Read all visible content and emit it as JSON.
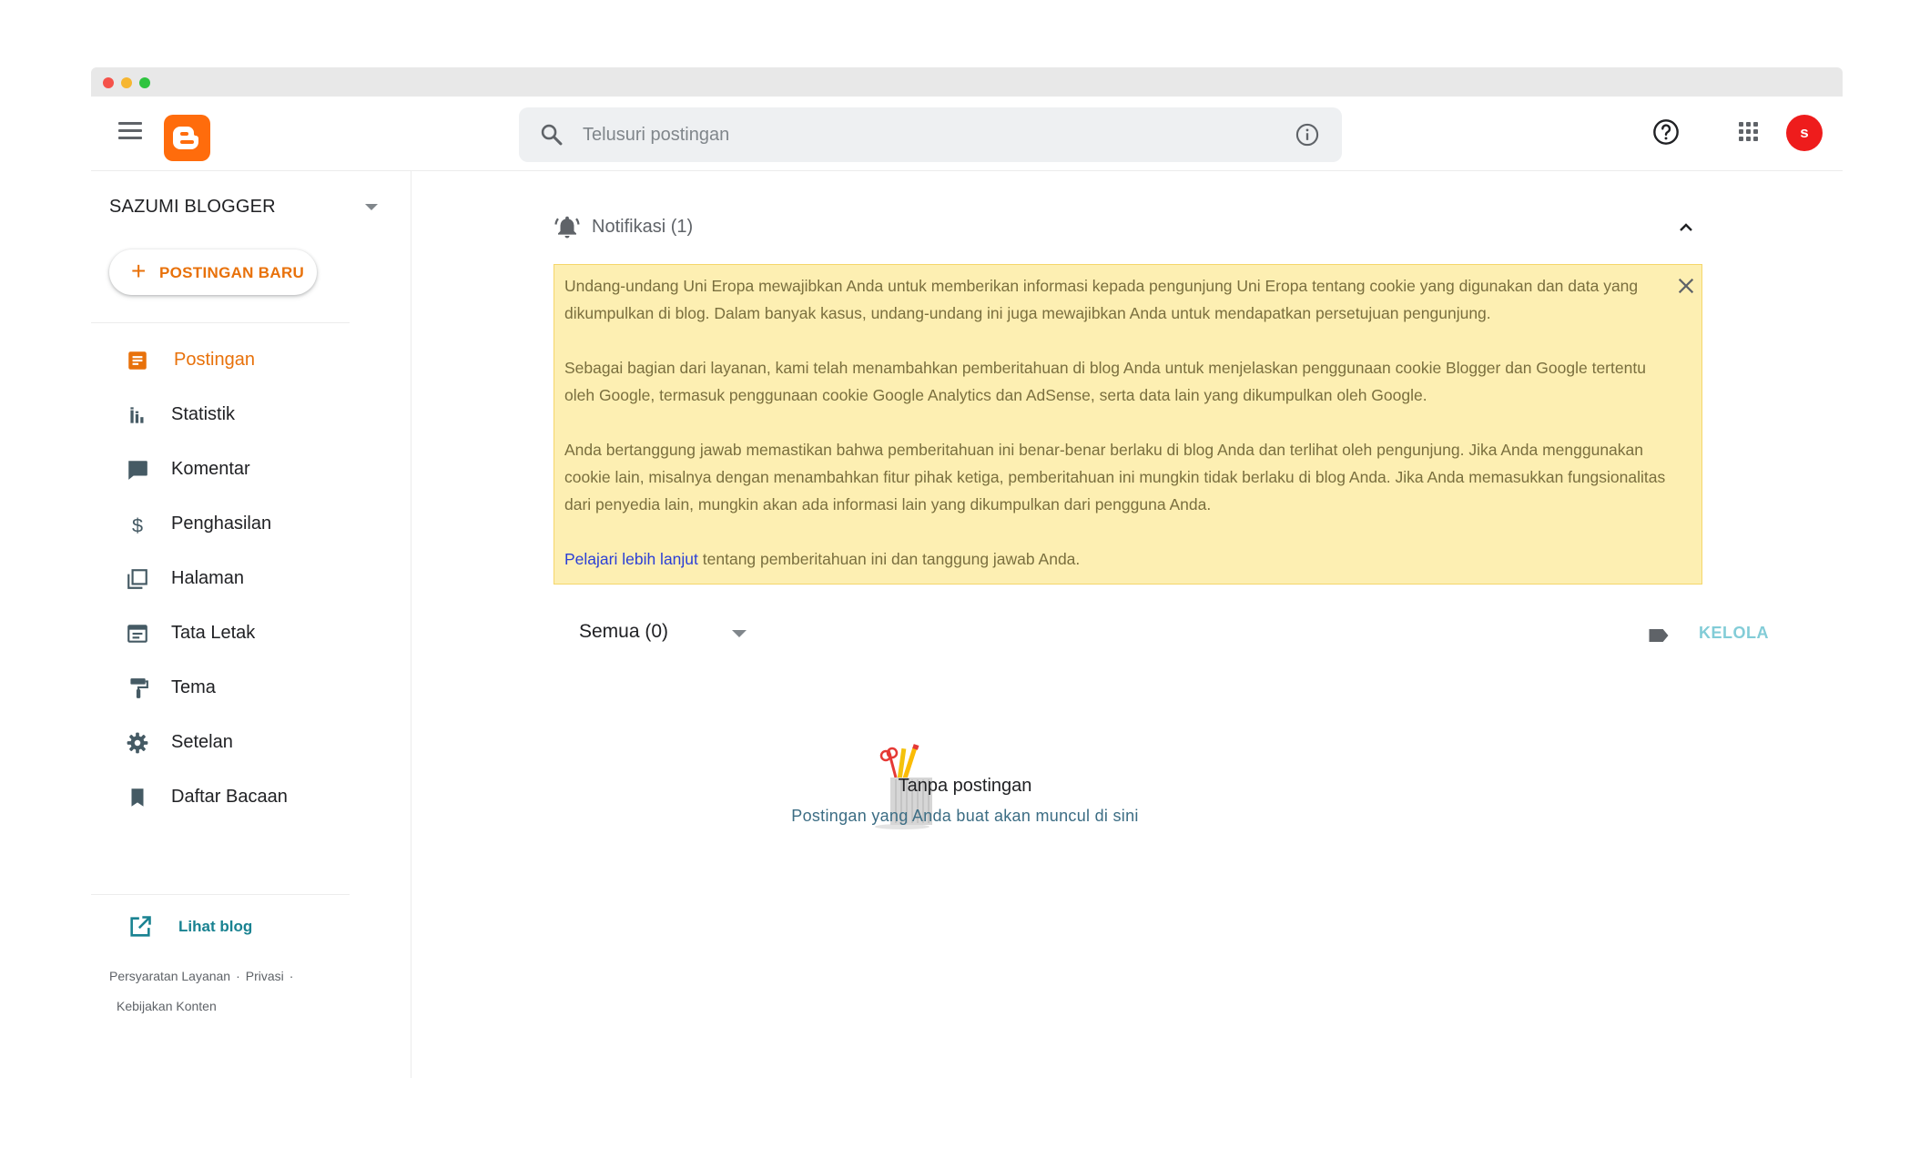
{
  "search": {
    "placeholder": "Telusuri postingan"
  },
  "header": {
    "avatar_letter": "s"
  },
  "sidebar": {
    "blog_name": "SAZUMI BLOGGER",
    "new_post_label": "POSTINGAN BARU",
    "items": [
      {
        "label": "Postingan",
        "icon": "posts-icon",
        "active": true
      },
      {
        "label": "Statistik",
        "icon": "stats-icon"
      },
      {
        "label": "Komentar",
        "icon": "comment-icon"
      },
      {
        "label": "Penghasilan",
        "icon": "dollar-icon"
      },
      {
        "label": "Halaman",
        "icon": "pages-icon"
      },
      {
        "label": "Tata Letak",
        "icon": "layout-icon"
      },
      {
        "label": "Tema",
        "icon": "paint-roller-icon"
      },
      {
        "label": "Setelan",
        "icon": "gear-icon"
      },
      {
        "label": "Daftar Bacaan",
        "icon": "bookmark-icon"
      }
    ],
    "view_blog_label": "Lihat blog",
    "footer": {
      "terms": "Persyaratan Layanan",
      "privacy": "Privasi",
      "content_policy": "Kebijakan Konten"
    }
  },
  "notifications": {
    "title": "Notifikasi (1)",
    "paragraphs": [
      "Undang-undang Uni Eropa mewajibkan Anda untuk memberikan informasi kepada pengunjung Uni Eropa tentang cookie yang digunakan dan data yang dikumpulkan di blog. Dalam banyak kasus, undang-undang ini juga mewajibkan Anda untuk mendapatkan persetujuan pengunjung.",
      "Sebagai bagian dari layanan, kami telah menambahkan pemberitahuan di blog Anda untuk menjelaskan penggunaan cookie Blogger dan Google tertentu oleh Google, termasuk penggunaan cookie Google Analytics dan AdSense, serta data lain yang dikumpulkan oleh Google.",
      "Anda bertanggung jawab memastikan bahwa pemberitahuan ini benar-benar berlaku di blog Anda dan terlihat oleh pengunjung. Jika Anda menggunakan cookie lain, misalnya dengan menambahkan fitur pihak ketiga, pemberitahuan ini mungkin tidak berlaku di blog Anda. Jika Anda memasukkan fungsionalitas dari penyedia lain, mungkin akan ada informasi lain yang dikumpulkan dari pengguna Anda."
    ],
    "learn_more_link": "Pelajari lebih lanjut",
    "learn_more_rest": " tentang pemberitahuan ini dan tanggung jawab Anda."
  },
  "posts": {
    "filter_label": "Semua (0)",
    "manage_label": "KELOLA",
    "empty_title": "Tanpa postingan",
    "empty_subtitle": "Postingan yang Anda buat akan muncul di sini"
  },
  "colors": {
    "brand": "#ff6c0c",
    "accent": "#e8710a",
    "notice_bg": "#fdefb2",
    "avatar": "#ee1c1c"
  }
}
